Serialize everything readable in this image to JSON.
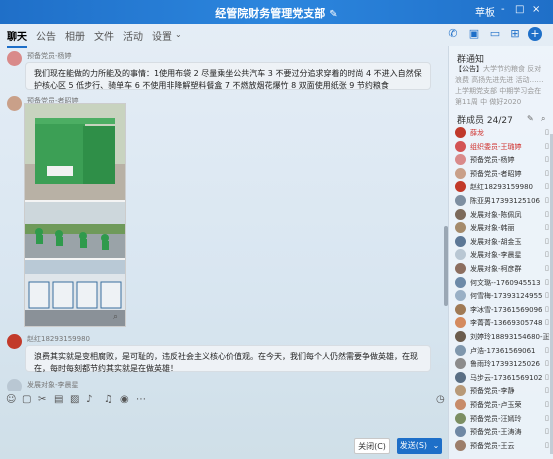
{
  "window": {
    "title": "经管院财务管理党支部",
    "right_label": "苹板",
    "controls": [
      "-",
      "□",
      "×"
    ]
  },
  "tabs": [
    {
      "label": "聊天",
      "active": true
    },
    {
      "label": "公告",
      "active": false
    },
    {
      "label": "相册",
      "active": false
    },
    {
      "label": "文件",
      "active": false
    },
    {
      "label": "活动",
      "active": false
    },
    {
      "label": "设置",
      "active": false
    }
  ],
  "messages": [
    {
      "sender": "预备党员-杨婷",
      "text": "我们现在能做的力所能及的事情：1使用布袋 2 尽量乘坐公共汽车 3 不要过分追求穿着的时尚 4 不进入自然保护核心区 5 低步行、骑单车 6 不使用非降解塑料餐盒 7 不燃放烟花爆竹 8 双面使用纸张 9 节约粮食",
      "avatar_color": "#d98a8a"
    },
    {
      "sender": "预备党员-者昭婷",
      "text": "",
      "avatar_color": "#c9a089"
    },
    {
      "sender": "赵红18293159980",
      "text": "浪费其实就是变相腐败，是可耻的，违反社会主义核心价值观。在今天，我们每个人仍然需要争做英雄，在现在，每时每刻都节约其实就是在做英雄！",
      "avatar_color": "#c23a2a"
    },
    {
      "sender": "发展对象-李晨星",
      "text": "",
      "avatar_color": "#b9c7d3"
    }
  ],
  "buttons": {
    "close": "关闭(C)",
    "send": "发送(S)"
  },
  "panel": {
    "notice_title": "群通知",
    "notice_label": "【公告】",
    "notice_text": "大学节约粮食 反对浪费 高扬先进先进 活动…… 上学期党支部 中期学习会在 第11周 中 做好2020",
    "members_title": "群成员 24/27",
    "members": [
      {
        "name": "薛龙",
        "color": "#c0392b",
        "red": true
      },
      {
        "name": "组织委员-王璐婷",
        "color": "#d35454",
        "red": true
      },
      {
        "name": "预备党员-杨婷",
        "color": "#d98a8a",
        "red": false
      },
      {
        "name": "预备党员-者昭婷",
        "color": "#c9a089",
        "red": false
      },
      {
        "name": "赵红18293159980",
        "color": "#c23a2a",
        "red": false
      },
      {
        "name": "陈亚男17393125106",
        "color": "#7e8fa1",
        "red": false
      },
      {
        "name": "发展对象-陈佩凤",
        "color": "#7c6a5a",
        "red": false
      },
      {
        "name": "发展对象-韩丽",
        "color": "#a58b6b",
        "red": false
      },
      {
        "name": "发展对象-胡金玉",
        "color": "#5d7896",
        "red": false
      },
      {
        "name": "发展对象-李晨星",
        "color": "#b9c7d3",
        "red": false
      },
      {
        "name": "发展对象-柯彦群",
        "color": "#8c6e5f",
        "red": false
      },
      {
        "name": "何文璐--1760945513",
        "color": "#6d8aa8",
        "red": false
      },
      {
        "name": "何雪梅-17393124955",
        "color": "#9ab0c6",
        "red": false
      },
      {
        "name": "李冰雪-17361569096",
        "color": "#a07a55",
        "red": false
      },
      {
        "name": "李菁菁-13669305748",
        "color": "#d48a5e",
        "red": false
      },
      {
        "name": "刘婷玲18893154680-正式",
        "color": "#6b5c4d",
        "red": false
      },
      {
        "name": "卢浩-17361569061",
        "color": "#7f97ad",
        "red": false
      },
      {
        "name": "鲁雨玲17393125026",
        "color": "#8c8c8c",
        "red": false
      },
      {
        "name": "马步云-17361569102",
        "color": "#5a6f84",
        "red": false
      },
      {
        "name": "预备党员-李静",
        "color": "#b89a78",
        "red": false
      },
      {
        "name": "预备党员-卢玉荣",
        "color": "#c78c6a",
        "red": false
      },
      {
        "name": "预备党员-汪嫣玲",
        "color": "#7b8e62",
        "red": false
      },
      {
        "name": "预备党员-王涛涛",
        "color": "#6f88a4",
        "red": false
      },
      {
        "name": "预备党员-王云",
        "color": "#9c7e6a",
        "red": false
      }
    ]
  }
}
